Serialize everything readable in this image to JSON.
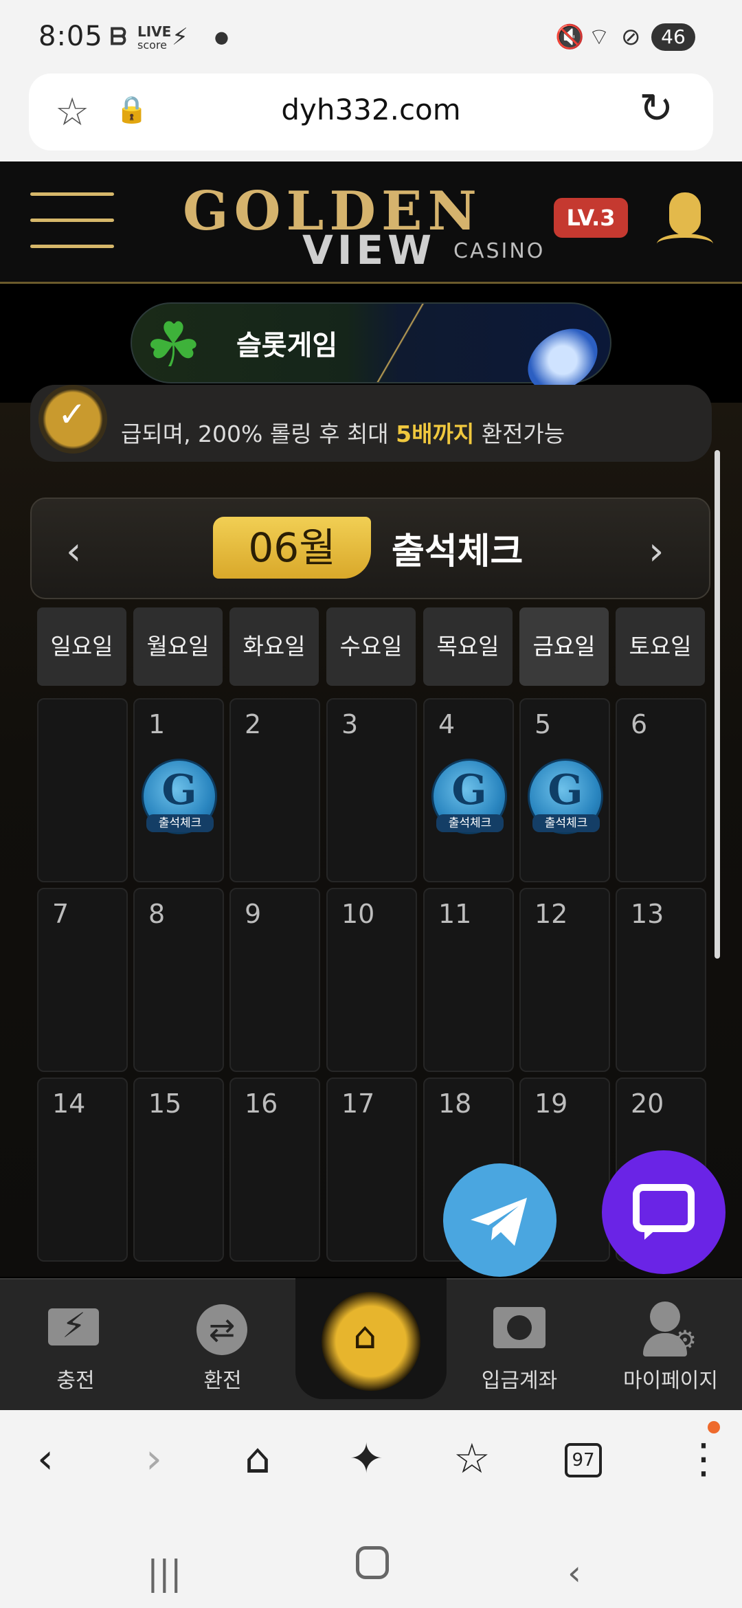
{
  "status_bar": {
    "time": "8:05",
    "live_label": "LIVE",
    "score_label": "score",
    "battery": "46"
  },
  "browser": {
    "url": "dyh332.com",
    "tabs_count": "97"
  },
  "header": {
    "logo_main": "GOLDEN",
    "logo_sub": "VIEW",
    "logo_casino": "CASINO",
    "level": "LV.3"
  },
  "banner": {
    "label": "슬롯게임"
  },
  "notice": {
    "text_prefix": "급되며, 200% 롤링 후 최대 ",
    "highlight": "5배까지",
    "text_suffix": " 환전가능"
  },
  "calendar": {
    "month": "06월",
    "title": "출석체크",
    "prev_icon": "chevron-left-icon",
    "next_icon": "chevron-right-icon",
    "weekdays": [
      "일요일",
      "월요일",
      "화요일",
      "수요일",
      "목요일",
      "금요일",
      "토요일"
    ],
    "today_weekday_index": 5,
    "rows": [
      [
        "",
        "1",
        "2",
        "3",
        "4",
        "5",
        "6"
      ],
      [
        "7",
        "8",
        "9",
        "10",
        "11",
        "12",
        "13"
      ],
      [
        "14",
        "15",
        "16",
        "17",
        "18",
        "19",
        "20"
      ]
    ],
    "stamp_label": "출석체크",
    "stamp_letter": "G",
    "checked_days": [
      "1",
      "4",
      "5"
    ]
  },
  "floating": {
    "telegram_icon": "telegram-icon",
    "chat_icon": "chat-icon"
  },
  "bottom_nav": {
    "items": [
      {
        "label": "충전",
        "icon": "charge-icon"
      },
      {
        "label": "환전",
        "icon": "exchange-icon"
      },
      {
        "label": "",
        "icon": "home-icon"
      },
      {
        "label": "입금계좌",
        "icon": "deposit-account-icon"
      },
      {
        "label": "마이페이지",
        "icon": "mypage-icon"
      }
    ]
  },
  "colors": {
    "gold": "#d9a82a",
    "level_red": "#c53930",
    "telegram_blue": "#4aa6e0",
    "chat_purple": "#6a24e6",
    "highlight_yellow": "#f0c83e"
  }
}
